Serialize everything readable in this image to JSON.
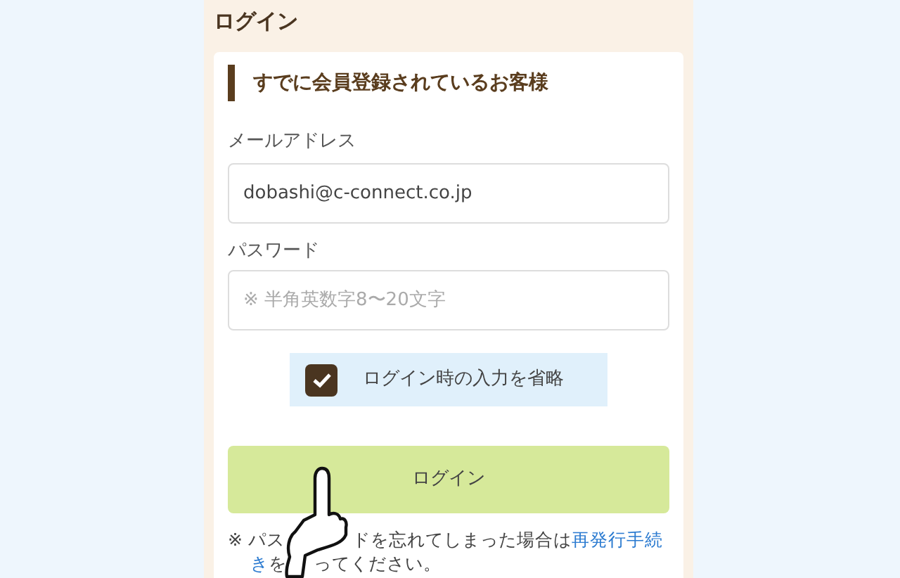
{
  "page_title": "ログイン",
  "section_heading": "すでに会員登録されているお客様",
  "email": {
    "label": "メールアドレス",
    "value": "dobashi@c-connect.co.jp"
  },
  "password": {
    "label": "パスワード",
    "placeholder": "※ 半角英数字8〜20文字"
  },
  "remember": {
    "label": "ログイン時の入力を省略",
    "checked": true
  },
  "login_button": "ログイン",
  "note": {
    "line_1": [
      "※ パス",
      "ドを忘れてしまった場合は"
    ],
    "link_1": "再発行手続",
    "link_2": "き",
    "line_2": [
      "を",
      "ってください。"
    ]
  }
}
